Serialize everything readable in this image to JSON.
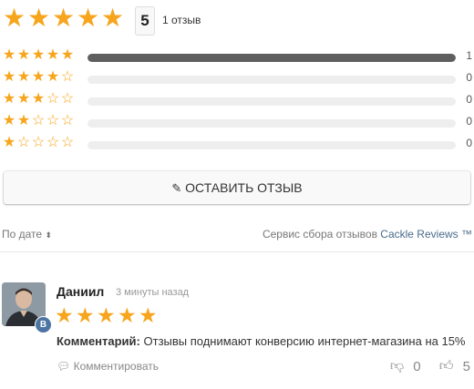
{
  "summary": {
    "score": "5",
    "count_label": "1 отзыв",
    "stars_filled": 5
  },
  "distribution": [
    {
      "stars": 5,
      "count": "1",
      "fill": 1.0
    },
    {
      "stars": 4,
      "count": "0",
      "fill": 0
    },
    {
      "stars": 3,
      "count": "0",
      "fill": 0
    },
    {
      "stars": 2,
      "count": "0",
      "fill": 0
    },
    {
      "stars": 1,
      "count": "0",
      "fill": 0
    }
  ],
  "leave_review": {
    "label": "ОСТАВИТЬ ОТЗЫВ",
    "icon": "pencil-icon"
  },
  "sort": {
    "label": "По дате",
    "icon": "sort-icon"
  },
  "service": {
    "prefix": "Сервис сбора отзывов",
    "link": "Cackle Reviews ™"
  },
  "review": {
    "author": "Даниил",
    "time": "3 минуты назад",
    "rating": 5,
    "badge": "В",
    "comment_label": "Комментарий:",
    "comment_text": "Отзывы поднимают конверсию интернет-магазина на 15%",
    "reply_label": "Комментировать",
    "dislikes": "0",
    "likes": "5"
  },
  "colors": {
    "star": "#f7a51c",
    "bar": "#5f5f5f",
    "track": "#eeeeee",
    "link": "#4a6b8a"
  }
}
